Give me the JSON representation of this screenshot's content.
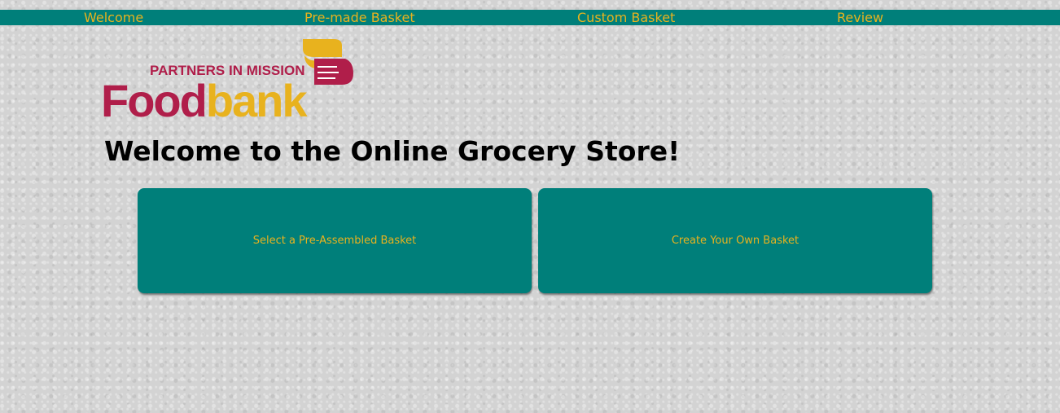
{
  "nav": {
    "items": [
      {
        "label": "Welcome"
      },
      {
        "label": "Pre-made Basket"
      },
      {
        "label": "Custom Basket"
      },
      {
        "label": "Review"
      }
    ]
  },
  "logo": {
    "tagline": "PARTNERS IN MISSION",
    "word_food": "Food",
    "word_bank": "bank",
    "colors": {
      "crimson": "#b01e4a",
      "gold": "#e8b21e"
    }
  },
  "main": {
    "title": "Welcome to the Online Grocery Store!",
    "buttons": [
      {
        "label": "Select a Pre-Assembled Basket"
      },
      {
        "label": "Create Your Own Basket"
      }
    ]
  },
  "colors": {
    "teal": "#007f7a",
    "gold": "#e8b21e",
    "background": "#d3d3d3"
  }
}
